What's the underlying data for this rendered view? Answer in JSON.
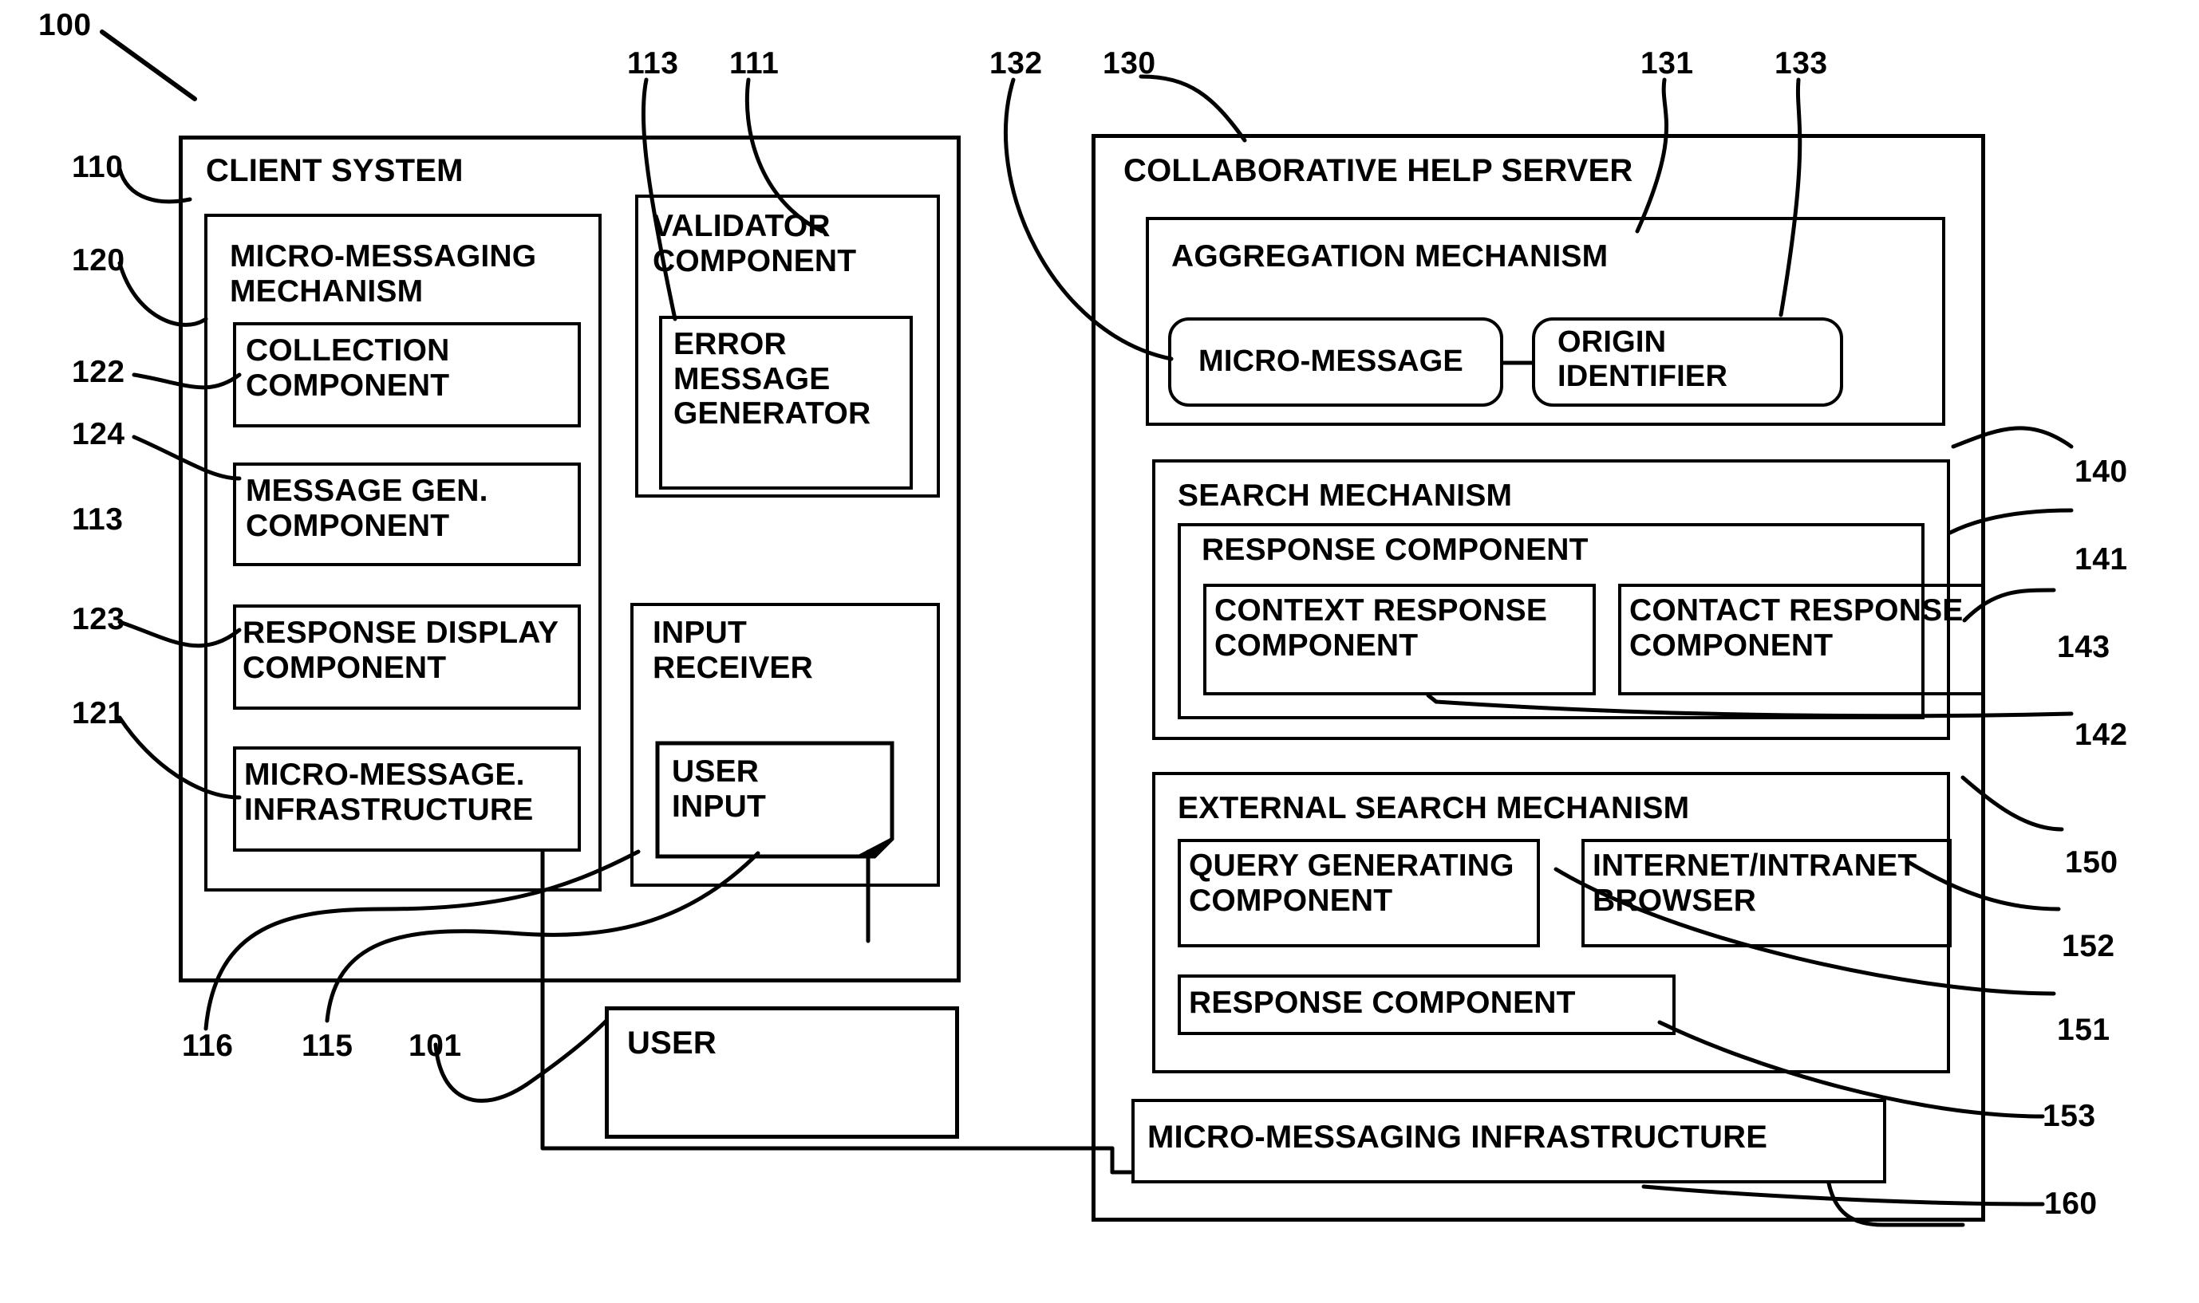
{
  "figure": {
    "number": "100",
    "type": "patent-block-diagram"
  },
  "client_system": {
    "title": "CLIENT SYSTEM",
    "ref": "110",
    "micro_messaging_mechanism": {
      "title": "MICRO-MESSAGING\nMECHANISM",
      "ref": "120",
      "children": [
        {
          "label": "COLLECTION\nCOMPONENT",
          "ref": "122"
        },
        {
          "label": "MESSAGE GEN.\nCOMPONENT",
          "ref": "124"
        },
        {
          "label": "RESPONSE DISPLAY\nCOMPONENT",
          "ref": "123"
        },
        {
          "label": "MICRO-MESSAGE.\nINFRASTRUCTURE",
          "ref": "121"
        }
      ]
    },
    "validator_component": {
      "title": "VALIDATOR\nCOMPONENT",
      "ref": "111",
      "children": [
        {
          "label": "ERROR\nMESSAGE\nGENERATOR",
          "ref": "113"
        }
      ]
    },
    "input_receiver": {
      "title": "INPUT\nRECEIVER",
      "ref": "115",
      "children": [
        {
          "label": "USER\nINPUT",
          "ref": "116"
        }
      ]
    }
  },
  "user": {
    "label": "USER",
    "ref": "101"
  },
  "help_server": {
    "title": "COLLABORATIVE HELP SERVER",
    "ref": "130",
    "aggregation_mechanism": {
      "title": "AGGREGATION MECHANISM",
      "ref": "131",
      "children": [
        {
          "label": "MICRO-MESSAGE",
          "ref": "132"
        },
        {
          "label": "ORIGIN\nIDENTIFIER",
          "ref": "133"
        }
      ]
    },
    "search_mechanism": {
      "title": "SEARCH MECHANISM",
      "ref": "140",
      "response_component": {
        "title": "RESPONSE COMPONENT",
        "ref": "141",
        "children": [
          {
            "label": "CONTEXT RESPONSE\nCOMPONENT",
            "ref": "142"
          },
          {
            "label": "CONTACT RESPONSE\nCOMPONENT",
            "ref": "143"
          }
        ]
      }
    },
    "external_search_mechanism": {
      "title": "EXTERNAL SEARCH MECHANISM",
      "ref": "150",
      "children": [
        {
          "label": "QUERY GENERATING\nCOMPONENT",
          "ref": "151"
        },
        {
          "label": "INTERNET/INTRANET\nBROWSER",
          "ref": "152"
        },
        {
          "label": "RESPONSE COMPONENT",
          "ref": "153"
        }
      ]
    },
    "micro_messaging_infrastructure": {
      "label": "MICRO-MESSAGING INFRASTRUCTURE",
      "ref": "160"
    }
  },
  "reference_numerals": {
    "fig": "100",
    "client_system": "110",
    "validator_component": "111",
    "error_message_generator_top": "113",
    "micro_messaging_mechanism": "120",
    "micro_message_infrastructure": "121",
    "collection_component": "122",
    "response_display_component": "123",
    "message_gen_component": "124",
    "message_gen_side": "113",
    "user_input": "116",
    "input_receiver": "115",
    "user": "101",
    "micro_message": "132",
    "help_server": "130",
    "aggregation_mechanism": "131",
    "origin_identifier": "133",
    "search_mechanism": "140",
    "response_component": "141",
    "contact_response_component": "143",
    "context_response_component": "142",
    "external_search_mechanism": "150",
    "internet_intranet_browser": "152",
    "query_generating_component": "151",
    "external_response_component": "153",
    "micro_messaging_infrastructure": "160"
  }
}
